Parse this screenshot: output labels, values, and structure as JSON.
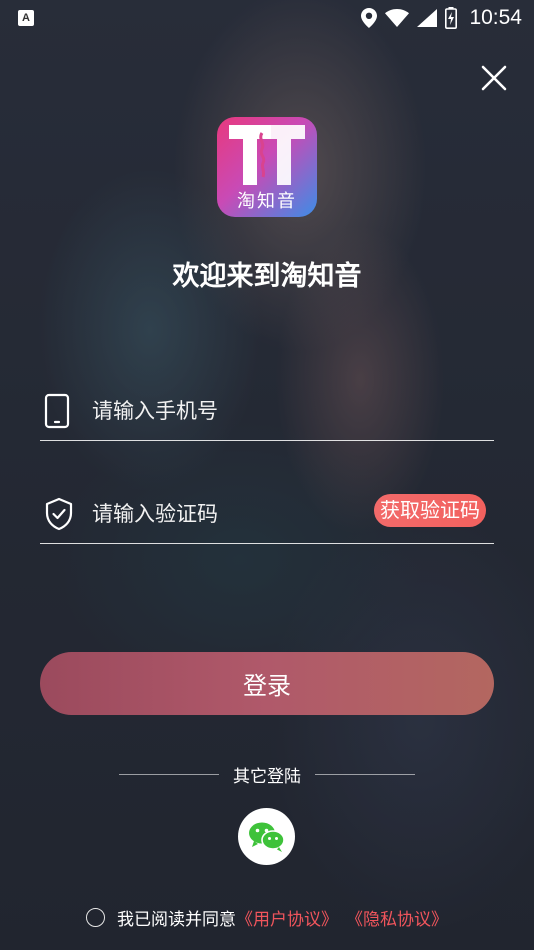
{
  "status_bar": {
    "notification_icon_label": "A",
    "time": "10:54",
    "icons": [
      "location-icon",
      "wifi-icon",
      "signal-icon",
      "battery-charging-icon"
    ]
  },
  "logo": {
    "app_name": "淘知音"
  },
  "welcome_title": "欢迎来到淘知音",
  "phone_field": {
    "placeholder": "请输入手机号",
    "value": ""
  },
  "code_field": {
    "placeholder": "请输入验证码",
    "value": ""
  },
  "get_code_label": "获取验证码",
  "login_label": "登录",
  "other_login_label": "其它登陆",
  "agreement": {
    "text": "我已阅读并同意",
    "user_agreement": "《用户协议》",
    "privacy_agreement": "《隐私协议》",
    "checked": false
  },
  "colors": {
    "accent": "#f2615e",
    "login_button": "#a8546a",
    "link": "#f1555c",
    "wechat_green": "#3ec23a"
  }
}
